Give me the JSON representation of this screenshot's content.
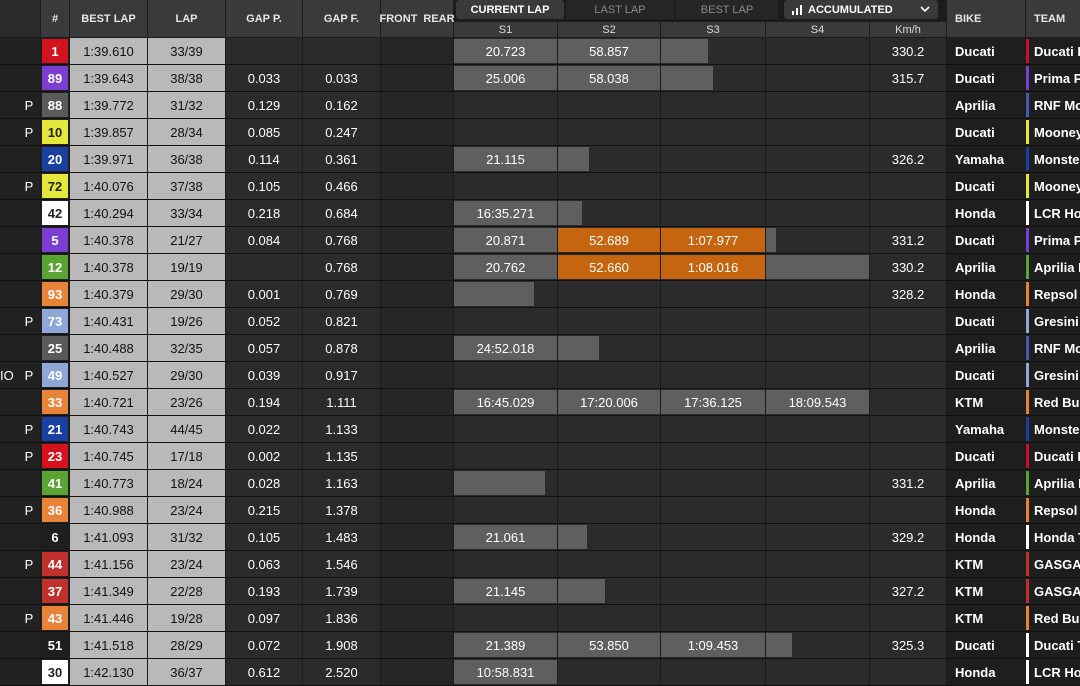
{
  "headers": {
    "number": "#",
    "best_lap": "BEST LAP",
    "lap": "LAP",
    "gap_p": "GAP P.",
    "gap_f": "GAP F.",
    "front": "FRONT",
    "rear": "REAR",
    "tab_current": "CURRENT LAP",
    "tab_last": "LAST LAP",
    "tab_best": "BEST LAP",
    "view_select": "ACCUMULATED",
    "s1": "S1",
    "s2": "S2",
    "s3": "S3",
    "s4": "S4",
    "kmh": "Km/h",
    "bike": "BIKE",
    "team": "TEAM"
  },
  "colors": {
    "orange_sector": "#c5650f",
    "gray_sector": "#5f5f5f"
  },
  "rows": [
    {
      "pre": "",
      "pit": "",
      "num": "1",
      "num_bg": "#d4121e",
      "num_fg": "#ffffff",
      "best": "1:39.610",
      "lap": "33/39",
      "gap_p": "",
      "gap_f": "",
      "s1": "20.723",
      "s1_bg": "#5f5f5f",
      "s2": "58.857",
      "s2_bg": "#5f5f5f",
      "s3": "",
      "s3_bg": "#5f5f5f",
      "s3_bar": 0.45,
      "s4": "",
      "s4_bg": "",
      "s4_bar": 0,
      "kmh": "330.2",
      "bike": "Ducati",
      "team": "Ducati Le",
      "team_color": "#c8102e"
    },
    {
      "pre": "",
      "pit": "",
      "num": "89",
      "num_bg": "#7a3fd0",
      "num_fg": "#ffffff",
      "best": "1:39.643",
      "lap": "38/38",
      "gap_p": "0.033",
      "gap_f": "0.033",
      "s1": "25.006",
      "s1_bg": "#5f5f5f",
      "s2": "58.038",
      "s2_bg": "#5f5f5f",
      "s3": "",
      "s3_bg": "#5f5f5f",
      "s3_bar": 0.5,
      "s4": "",
      "s4_bg": "",
      "s4_bar": 0,
      "kmh": "315.7",
      "bike": "Ducati",
      "team": "Prima Pr",
      "team_color": "#7a3fd0"
    },
    {
      "pre": "",
      "pit": "P",
      "num": "88",
      "num_bg": "#5a5a5a",
      "num_fg": "#ffffff",
      "best": "1:39.772",
      "lap": "31/32",
      "gap_p": "0.129",
      "gap_f": "0.162",
      "s1": "",
      "s1_bg": "",
      "s2": "",
      "s2_bg": "",
      "s3": "",
      "s3_bg": "",
      "s3_bar": 0,
      "s4": "",
      "s4_bg": "",
      "s4_bar": 0,
      "kmh": "",
      "bike": "Aprilia",
      "team": "RNF Mot",
      "team_color": "#4a5bb5"
    },
    {
      "pre": "",
      "pit": "P",
      "num": "10",
      "num_bg": "#e3e83a",
      "num_fg": "#222222",
      "best": "1:39.857",
      "lap": "28/34",
      "gap_p": "0.085",
      "gap_f": "0.247",
      "s1": "",
      "s1_bg": "",
      "s2": "",
      "s2_bg": "",
      "s3": "",
      "s3_bg": "",
      "s3_bar": 0,
      "s4": "",
      "s4_bg": "",
      "s4_bar": 0,
      "kmh": "",
      "bike": "Ducati",
      "team": "Mooney",
      "team_color": "#e3e83a"
    },
    {
      "pre": "",
      "pit": "",
      "num": "20",
      "num_bg": "#1b3fa0",
      "num_fg": "#ffffff",
      "best": "1:39.971",
      "lap": "36/38",
      "gap_p": "0.114",
      "gap_f": "0.361",
      "s1": "21.115",
      "s1_bg": "#5f5f5f",
      "s2": "",
      "s2_bg": "#5f5f5f",
      "s2_bar": 0.3,
      "s3": "",
      "s3_bg": "",
      "s3_bar": 0,
      "s4": "",
      "s4_bg": "",
      "s4_bar": 0,
      "kmh": "326.2",
      "bike": "Yamaha",
      "team": "Monster",
      "team_color": "#1b3fa0"
    },
    {
      "pre": "",
      "pit": "P",
      "num": "72",
      "num_bg": "#e3e83a",
      "num_fg": "#222222",
      "best": "1:40.076",
      "lap": "37/38",
      "gap_p": "0.105",
      "gap_f": "0.466",
      "s1": "",
      "s1_bg": "",
      "s2": "",
      "s2_bg": "",
      "s3": "",
      "s3_bg": "",
      "s3_bar": 0,
      "s4": "",
      "s4_bg": "",
      "s4_bar": 0,
      "kmh": "",
      "bike": "Ducati",
      "team": "Mooney",
      "team_color": "#e3e83a"
    },
    {
      "pre": "",
      "pit": "",
      "num": "42",
      "num_bg": "#ffffff",
      "num_fg": "#222222",
      "best": "1:40.294",
      "lap": "33/34",
      "gap_p": "0.218",
      "gap_f": "0.684",
      "s1": "16:35.271",
      "s1_bg": "#5f5f5f",
      "s2": "",
      "s2_bg": "#5f5f5f",
      "s2_bar": 0.24,
      "s3": "",
      "s3_bg": "",
      "s3_bar": 0,
      "s4": "",
      "s4_bg": "",
      "s4_bar": 0,
      "kmh": "",
      "bike": "Honda",
      "team": "LCR Hon",
      "team_color": "#ffffff"
    },
    {
      "pre": "",
      "pit": "",
      "num": "5",
      "num_bg": "#7a3fd0",
      "num_fg": "#ffffff",
      "best": "1:40.378",
      "lap": "21/27",
      "gap_p": "0.084",
      "gap_f": "0.768",
      "s1": "20.871",
      "s1_bg": "#5f5f5f",
      "s2": "52.689",
      "s2_bg": "#c5650f",
      "s3": "1:07.977",
      "s3_bg": "#c5650f",
      "s3_bar": 1,
      "s4": "",
      "s4_bg": "#5f5f5f",
      "s4_bar": 0.1,
      "kmh": "331.2",
      "bike": "Ducati",
      "team": "Prima Pr",
      "team_color": "#7a3fd0"
    },
    {
      "pre": "",
      "pit": "",
      "num": "12",
      "num_bg": "#5aa532",
      "num_fg": "#ffffff",
      "best": "1:40.378",
      "lap": "19/19",
      "gap_p": "",
      "gap_f": "0.768",
      "s1": "20.762",
      "s1_bg": "#5f5f5f",
      "s2": "52.660",
      "s2_bg": "#c5650f",
      "s3": "1:08.016",
      "s3_bg": "#c5650f",
      "s3_bar": 1,
      "s4": "",
      "s4_bg": "#5f5f5f",
      "s4_bar": 1,
      "kmh": "330.2",
      "bike": "Aprilia",
      "team": "Aprilia R",
      "team_color": "#5aa532"
    },
    {
      "pre": "",
      "pit": "",
      "num": "93",
      "num_bg": "#e8833a",
      "num_fg": "#ffffff",
      "best": "1:40.379",
      "lap": "29/30",
      "gap_p": "0.001",
      "gap_f": "0.769",
      "s1": "",
      "s1_bg": "#5f5f5f",
      "s1_bar": 0.78,
      "s2": "",
      "s2_bg": "",
      "s3": "",
      "s3_bg": "",
      "s3_bar": 0,
      "s4": "",
      "s4_bg": "",
      "s4_bar": 0,
      "kmh": "328.2",
      "bike": "Honda",
      "team": "Repsol H",
      "team_color": "#e8833a"
    },
    {
      "pre": "",
      "pit": "P",
      "num": "73",
      "num_bg": "#8fa7d8",
      "num_fg": "#ffffff",
      "best": "1:40.431",
      "lap": "19/26",
      "gap_p": "0.052",
      "gap_f": "0.821",
      "s1": "",
      "s1_bg": "",
      "s2": "",
      "s2_bg": "",
      "s3": "",
      "s3_bg": "",
      "s3_bar": 0,
      "s4": "",
      "s4_bg": "",
      "s4_bar": 0,
      "kmh": "",
      "bike": "Ducati",
      "team": "Gresini R",
      "team_color": "#8fa7d8"
    },
    {
      "pre": "",
      "pit": "",
      "num": "25",
      "num_bg": "#5a5a5a",
      "num_fg": "#ffffff",
      "best": "1:40.488",
      "lap": "32/35",
      "gap_p": "0.057",
      "gap_f": "0.878",
      "s1": "24:52.018",
      "s1_bg": "#5f5f5f",
      "s2": "",
      "s2_bg": "#5f5f5f",
      "s2_bar": 0.4,
      "s3": "",
      "s3_bg": "",
      "s3_bar": 0,
      "s4": "",
      "s4_bg": "",
      "s4_bar": 0,
      "kmh": "",
      "bike": "Aprilia",
      "team": "RNF Mot",
      "team_color": "#4a5bb5"
    },
    {
      "pre": "IO",
      "pit": "P",
      "num": "49",
      "num_bg": "#8fa7d8",
      "num_fg": "#ffffff",
      "best": "1:40.527",
      "lap": "29/30",
      "gap_p": "0.039",
      "gap_f": "0.917",
      "s1": "",
      "s1_bg": "",
      "s2": "",
      "s2_bg": "",
      "s3": "",
      "s3_bg": "",
      "s3_bar": 0,
      "s4": "",
      "s4_bg": "",
      "s4_bar": 0,
      "kmh": "",
      "bike": "Ducati",
      "team": "Gresini R",
      "team_color": "#8fa7d8"
    },
    {
      "pre": "",
      "pit": "",
      "num": "33",
      "num_bg": "#e8833a",
      "num_fg": "#ffffff",
      "best": "1:40.721",
      "lap": "23/26",
      "gap_p": "0.194",
      "gap_f": "1.111",
      "s1": "16:45.029",
      "s1_bg": "#5f5f5f",
      "s2": "17:20.006",
      "s2_bg": "#5f5f5f",
      "s3": "17:36.125",
      "s3_bg": "#5f5f5f",
      "s3_bar": 1,
      "s4": "18:09.543",
      "s4_bg": "#5f5f5f",
      "s4_bar": 1,
      "kmh": "",
      "bike": "KTM",
      "team": "Red Bull",
      "team_color": "#e8833a"
    },
    {
      "pre": "",
      "pit": "P",
      "num": "21",
      "num_bg": "#1b3fa0",
      "num_fg": "#ffffff",
      "best": "1:40.743",
      "lap": "44/45",
      "gap_p": "0.022",
      "gap_f": "1.133",
      "s1": "",
      "s1_bg": "",
      "s2": "",
      "s2_bg": "",
      "s3": "",
      "s3_bg": "",
      "s3_bar": 0,
      "s4": "",
      "s4_bg": "",
      "s4_bar": 0,
      "kmh": "",
      "bike": "Yamaha",
      "team": "Monster",
      "team_color": "#1b3fa0"
    },
    {
      "pre": "",
      "pit": "P",
      "num": "23",
      "num_bg": "#d4121e",
      "num_fg": "#ffffff",
      "best": "1:40.745",
      "lap": "17/18",
      "gap_p": "0.002",
      "gap_f": "1.135",
      "s1": "",
      "s1_bg": "",
      "s2": "",
      "s2_bg": "",
      "s3": "",
      "s3_bg": "",
      "s3_bar": 0,
      "s4": "",
      "s4_bg": "",
      "s4_bar": 0,
      "kmh": "",
      "bike": "Ducati",
      "team": "Ducati Le",
      "team_color": "#c8102e"
    },
    {
      "pre": "",
      "pit": "",
      "num": "41",
      "num_bg": "#5aa532",
      "num_fg": "#ffffff",
      "best": "1:40.773",
      "lap": "18/24",
      "gap_p": "0.028",
      "gap_f": "1.163",
      "s1": "",
      "s1_bg": "#5f5f5f",
      "s1_bar": 0.88,
      "s2": "",
      "s2_bg": "",
      "s3": "",
      "s3_bg": "",
      "s3_bar": 0,
      "s4": "",
      "s4_bg": "",
      "s4_bar": 0,
      "kmh": "331.2",
      "bike": "Aprilia",
      "team": "Aprilia R",
      "team_color": "#5aa532"
    },
    {
      "pre": "",
      "pit": "P",
      "num": "36",
      "num_bg": "#e8833a",
      "num_fg": "#ffffff",
      "best": "1:40.988",
      "lap": "23/24",
      "gap_p": "0.215",
      "gap_f": "1.378",
      "s1": "",
      "s1_bg": "",
      "s2": "",
      "s2_bg": "",
      "s3": "",
      "s3_bg": "",
      "s3_bar": 0,
      "s4": "",
      "s4_bg": "",
      "s4_bar": 0,
      "kmh": "",
      "bike": "Honda",
      "team": "Repsol H",
      "team_color": "#e8833a"
    },
    {
      "pre": "",
      "pit": "",
      "num": "6",
      "num_bg": "#1e1e1e",
      "num_fg": "#ffffff",
      "best": "1:41.093",
      "lap": "31/32",
      "gap_p": "0.105",
      "gap_f": "1.483",
      "s1": "21.061",
      "s1_bg": "#5f5f5f",
      "s2": "",
      "s2_bg": "#5f5f5f",
      "s2_bar": 0.28,
      "s3": "",
      "s3_bg": "",
      "s3_bar": 0,
      "s4": "",
      "s4_bg": "",
      "s4_bar": 0,
      "kmh": "329.2",
      "bike": "Honda",
      "team": "Honda T",
      "team_color": "#ffffff"
    },
    {
      "pre": "",
      "pit": "P",
      "num": "44",
      "num_bg": "#c0312d",
      "num_fg": "#ffffff",
      "best": "1:41.156",
      "lap": "23/24",
      "gap_p": "0.063",
      "gap_f": "1.546",
      "s1": "",
      "s1_bg": "",
      "s2": "",
      "s2_bg": "",
      "s3": "",
      "s3_bg": "",
      "s3_bar": 0,
      "s4": "",
      "s4_bg": "",
      "s4_bar": 0,
      "kmh": "",
      "bike": "KTM",
      "team": "GASGAS",
      "team_color": "#c0312d"
    },
    {
      "pre": "",
      "pit": "",
      "num": "37",
      "num_bg": "#c0312d",
      "num_fg": "#ffffff",
      "best": "1:41.349",
      "lap": "22/28",
      "gap_p": "0.193",
      "gap_f": "1.739",
      "s1": "21.145",
      "s1_bg": "#5f5f5f",
      "s2": "",
      "s2_bg": "#5f5f5f",
      "s2_bar": 0.46,
      "s3": "",
      "s3_bg": "",
      "s3_bar": 0,
      "s4": "",
      "s4_bg": "",
      "s4_bar": 0,
      "kmh": "327.2",
      "bike": "KTM",
      "team": "GASGAS",
      "team_color": "#c0312d"
    },
    {
      "pre": "",
      "pit": "P",
      "num": "43",
      "num_bg": "#e8833a",
      "num_fg": "#ffffff",
      "best": "1:41.446",
      "lap": "19/28",
      "gap_p": "0.097",
      "gap_f": "1.836",
      "s1": "",
      "s1_bg": "",
      "s2": "",
      "s2_bg": "",
      "s3": "",
      "s3_bg": "",
      "s3_bar": 0,
      "s4": "",
      "s4_bg": "",
      "s4_bar": 0,
      "kmh": "",
      "bike": "KTM",
      "team": "Red Bull",
      "team_color": "#e8833a"
    },
    {
      "pre": "",
      "pit": "",
      "num": "51",
      "num_bg": "#1e1e1e",
      "num_fg": "#ffffff",
      "best": "1:41.518",
      "lap": "28/29",
      "gap_p": "0.072",
      "gap_f": "1.908",
      "s1": "21.389",
      "s1_bg": "#5f5f5f",
      "s2": "53.850",
      "s2_bg": "#5f5f5f",
      "s3": "1:09.453",
      "s3_bg": "#5f5f5f",
      "s3_bar": 1,
      "s4": "",
      "s4_bg": "#5f5f5f",
      "s4_bar": 0.25,
      "kmh": "325.3",
      "bike": "Ducati",
      "team": "Ducati T",
      "team_color": "#ffffff"
    },
    {
      "pre": "",
      "pit": "",
      "num": "30",
      "num_bg": "#ffffff",
      "num_fg": "#222222",
      "best": "1:42.130",
      "lap": "36/37",
      "gap_p": "0.612",
      "gap_f": "2.520",
      "s1": "10:58.831",
      "s1_bg": "#5f5f5f",
      "s2": "",
      "s2_bg": "",
      "s3": "",
      "s3_bg": "",
      "s3_bar": 0,
      "s4": "",
      "s4_bg": "",
      "s4_bar": 0,
      "kmh": "",
      "bike": "Honda",
      "team": "LCR Hon",
      "team_color": "#ffffff"
    }
  ]
}
